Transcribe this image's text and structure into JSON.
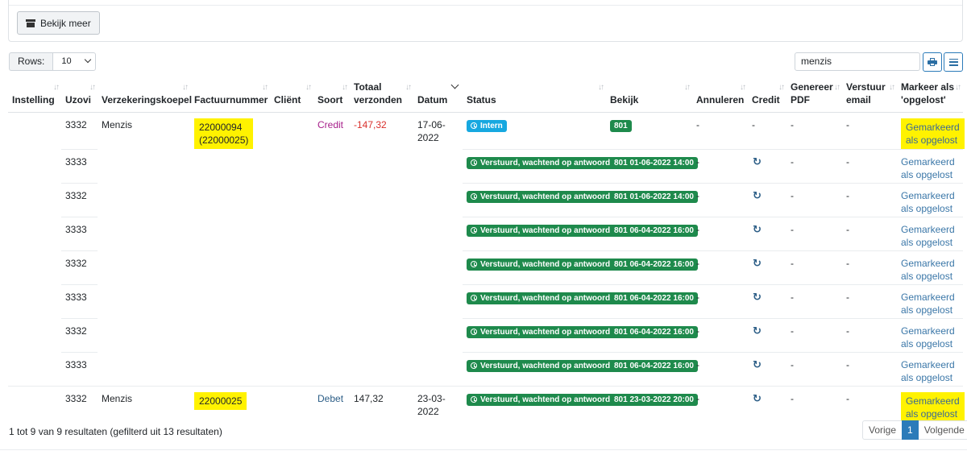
{
  "toolbar": {
    "more_label": "Bekijk meer"
  },
  "rows_control": {
    "label": "Rows:",
    "value": "10"
  },
  "search": {
    "value": "menzis"
  },
  "columns": [
    "Instelling",
    "Uzovi",
    "Verzekeringskoepel",
    "Factuurnummer",
    "Cliënt",
    "Soort",
    "Totaal verzonden",
    "Datum",
    "Status",
    "Bekijk",
    "Annuleren",
    "Credit",
    "Genereer PDF",
    "Verstuur email",
    "Markeer als 'opgelost'"
  ],
  "rows": [
    {
      "instelling": "",
      "uzovi": "3332",
      "koepel": "Menzis",
      "factuur": "22000094",
      "factuur_sub": "(22000025)",
      "client": "",
      "soort": "Credit",
      "totaal": "-147,32",
      "datum": "17-06-2022",
      "status": "Intern",
      "bekijk": "801",
      "annuleren": "-",
      "credit": "-",
      "pdf": "-",
      "email": "-",
      "markeer": "Gemarkeerd als opgelost"
    },
    {
      "instelling": "",
      "uzovi": "3333",
      "koepel": "",
      "factuur": "",
      "factuur_sub": "",
      "client": "",
      "soort": "",
      "totaal": "",
      "datum": "",
      "status": "Verstuurd, wachtend op antwoord",
      "bekijk": "801 01-06-2022 14:00",
      "annuleren": "-",
      "credit": "↻",
      "pdf": "-",
      "email": "-",
      "markeer": "Gemarkeerd als opgelost"
    },
    {
      "instelling": "",
      "uzovi": "3332",
      "koepel": "",
      "factuur": "",
      "factuur_sub": "",
      "client": "",
      "soort": "",
      "totaal": "",
      "datum": "",
      "status": "Verstuurd, wachtend op antwoord",
      "bekijk": "801 01-06-2022 14:00",
      "annuleren": "-",
      "credit": "↻",
      "pdf": "-",
      "email": "-",
      "markeer": "Gemarkeerd als opgelost"
    },
    {
      "instelling": "",
      "uzovi": "3333",
      "koepel": "",
      "factuur": "",
      "factuur_sub": "",
      "client": "",
      "soort": "",
      "totaal": "",
      "datum": "",
      "status": "Verstuurd, wachtend op antwoord",
      "bekijk": "801 06-04-2022 16:00",
      "annuleren": "-",
      "credit": "↻",
      "pdf": "-",
      "email": "-",
      "markeer": "Gemarkeerd als opgelost"
    },
    {
      "instelling": "",
      "uzovi": "3332",
      "koepel": "",
      "factuur": "",
      "factuur_sub": "",
      "client": "",
      "soort": "",
      "totaal": "",
      "datum": "",
      "status": "Verstuurd, wachtend op antwoord",
      "bekijk": "801 06-04-2022 16:00",
      "annuleren": "-",
      "credit": "↻",
      "pdf": "-",
      "email": "-",
      "markeer": "Gemarkeerd als opgelost"
    },
    {
      "instelling": "",
      "uzovi": "3333",
      "koepel": "",
      "factuur": "",
      "factuur_sub": "",
      "client": "",
      "soort": "",
      "totaal": "",
      "datum": "",
      "status": "Verstuurd, wachtend op antwoord",
      "bekijk": "801 06-04-2022 16:00",
      "annuleren": "-",
      "credit": "↻",
      "pdf": "-",
      "email": "-",
      "markeer": "Gemarkeerd als opgelost"
    },
    {
      "instelling": "",
      "uzovi": "3332",
      "koepel": "",
      "factuur": "",
      "factuur_sub": "",
      "client": "",
      "soort": "",
      "totaal": "",
      "datum": "",
      "status": "Verstuurd, wachtend op antwoord",
      "bekijk": "801 06-04-2022 16:00",
      "annuleren": "-",
      "credit": "↻",
      "pdf": "-",
      "email": "-",
      "markeer": "Gemarkeerd als opgelost"
    },
    {
      "instelling": "",
      "uzovi": "3333",
      "koepel": "",
      "factuur": "",
      "factuur_sub": "",
      "client": "",
      "soort": "",
      "totaal": "",
      "datum": "",
      "status": "Verstuurd, wachtend op antwoord",
      "bekijk": "801 06-04-2022 16:00",
      "annuleren": "-",
      "credit": "↻",
      "pdf": "-",
      "email": "-",
      "markeer": "Gemarkeerd als opgelost"
    },
    {
      "instelling": "",
      "uzovi": "3332",
      "koepel": "Menzis",
      "factuur": "22000025",
      "factuur_sub": "",
      "client": "",
      "soort": "Debet",
      "totaal": "147,32",
      "datum": "23-03-2022",
      "status": "Verstuurd, wachtend op antwoord",
      "bekijk": "801 23-03-2022 20:00",
      "annuleren": "-",
      "credit": "↻",
      "pdf": "-",
      "email": "-",
      "markeer": "Gemarkeerd als opgelost"
    }
  ],
  "footer": {
    "summary": "1 tot 9 van 9 resultaten (gefilterd uit 13 resultaten)"
  },
  "pagination": {
    "prev": "Vorige",
    "current": "1",
    "next": "Volgende"
  },
  "colors": {
    "highlight": "#fff200",
    "badge_green": "#1e8a4c",
    "badge_info": "#17a8e0",
    "link": "#3b77a8",
    "credit": "#a61e8a",
    "negative": "#d9302c"
  }
}
